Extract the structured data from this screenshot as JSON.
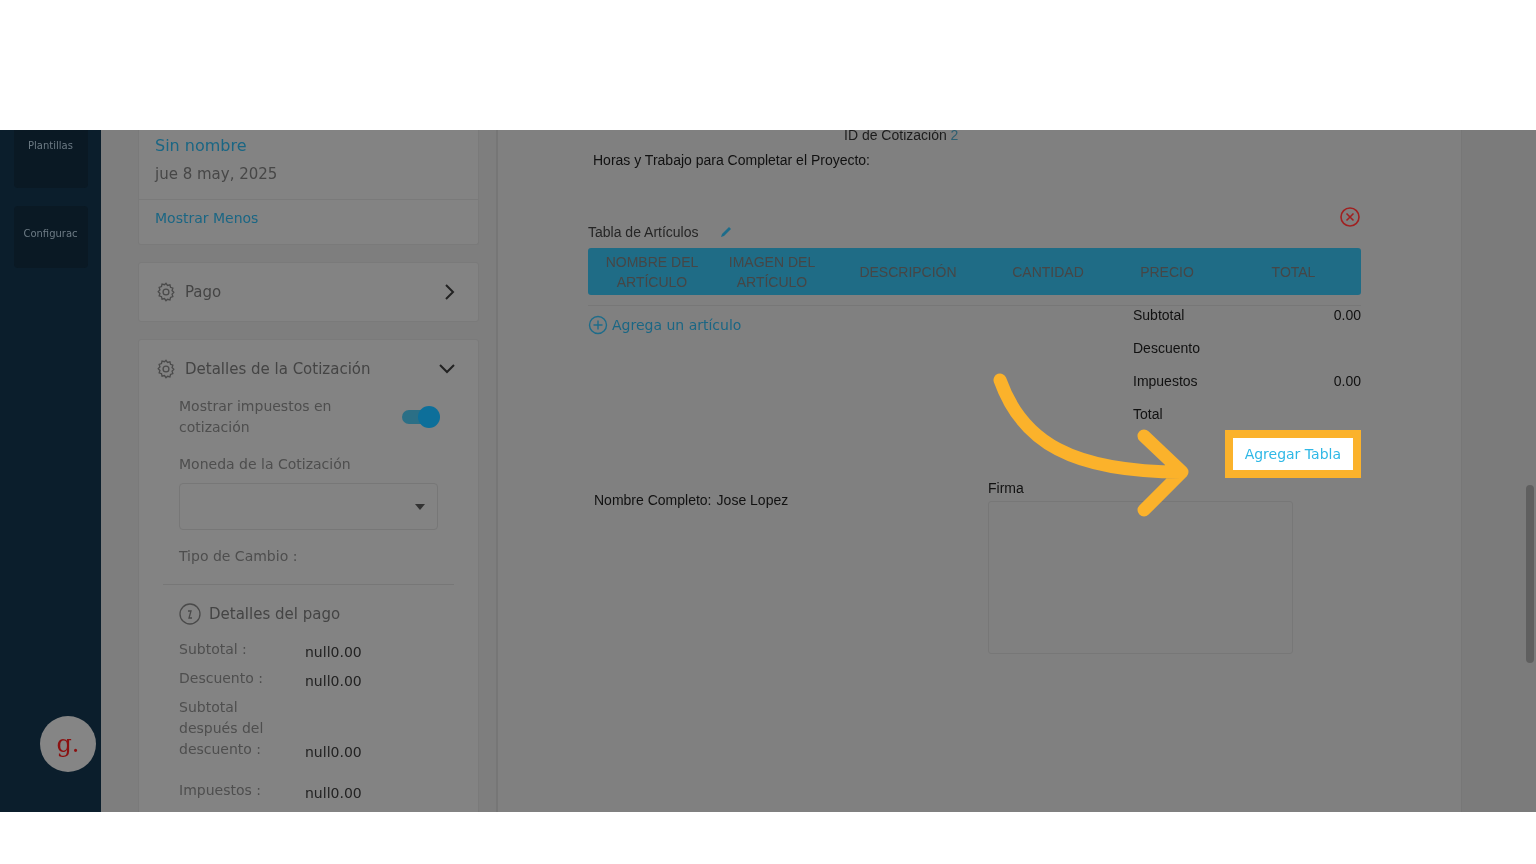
{
  "nav": {
    "items": [
      {
        "label": "Plantillas"
      },
      {
        "label": "Configurac"
      }
    ],
    "avatar": "g."
  },
  "quote_card": {
    "title": "Sin nombre",
    "date": "jue 8 may, 2025",
    "link": "Mostrar Menos"
  },
  "sections": [
    {
      "title": "Pago",
      "expanded": false
    },
    {
      "title": "Detalles de la Cotización",
      "expanded": true
    }
  ],
  "settings": {
    "tax_toggle": {
      "label": "Mostrar impuestos en cotización",
      "on": true
    },
    "currency": {
      "label": "Moneda de la Cotización"
    },
    "exchange_rate": {
      "label": "Tipo de Cambio :"
    }
  },
  "payment_details": {
    "title": "Detalles del pago",
    "rows": [
      {
        "label": "Subtotal :",
        "value": "null0.00"
      },
      {
        "label": "Descuento :",
        "value": "null0.00"
      },
      {
        "label": "Subtotal después del descuento :",
        "value": "null0.00"
      },
      {
        "label": "Impuestos :",
        "value": "null0.00"
      }
    ]
  },
  "document": {
    "quote_id": {
      "label": "ID de Cotización",
      "value": "2"
    },
    "heading": "Horas y Trabajo para Completar el Proyecto:",
    "table": {
      "title": "Tabla de Artículos",
      "columns": [
        "NOMBRE DEL ARTÍCULO",
        "IMAGEN DEL ARTÍCULO",
        "DESCRIPCIÓN",
        "CANTIDAD",
        "PRECIO",
        "TOTAL"
      ],
      "add_item": "Agrega un artículo",
      "totals": [
        {
          "label": "Subtotal",
          "value": "0.00"
        },
        {
          "label": "Descuento"
        },
        {
          "label": "Impuestos",
          "value": "0.00"
        },
        {
          "label": "Total"
        }
      ]
    },
    "add_table": {
      "label": "Agregar Tabla",
      "highlighted": true
    },
    "name": {
      "label": "Nombre Completo:",
      "value": "Jose Lopez"
    },
    "signature": {
      "label": "Firma"
    }
  }
}
